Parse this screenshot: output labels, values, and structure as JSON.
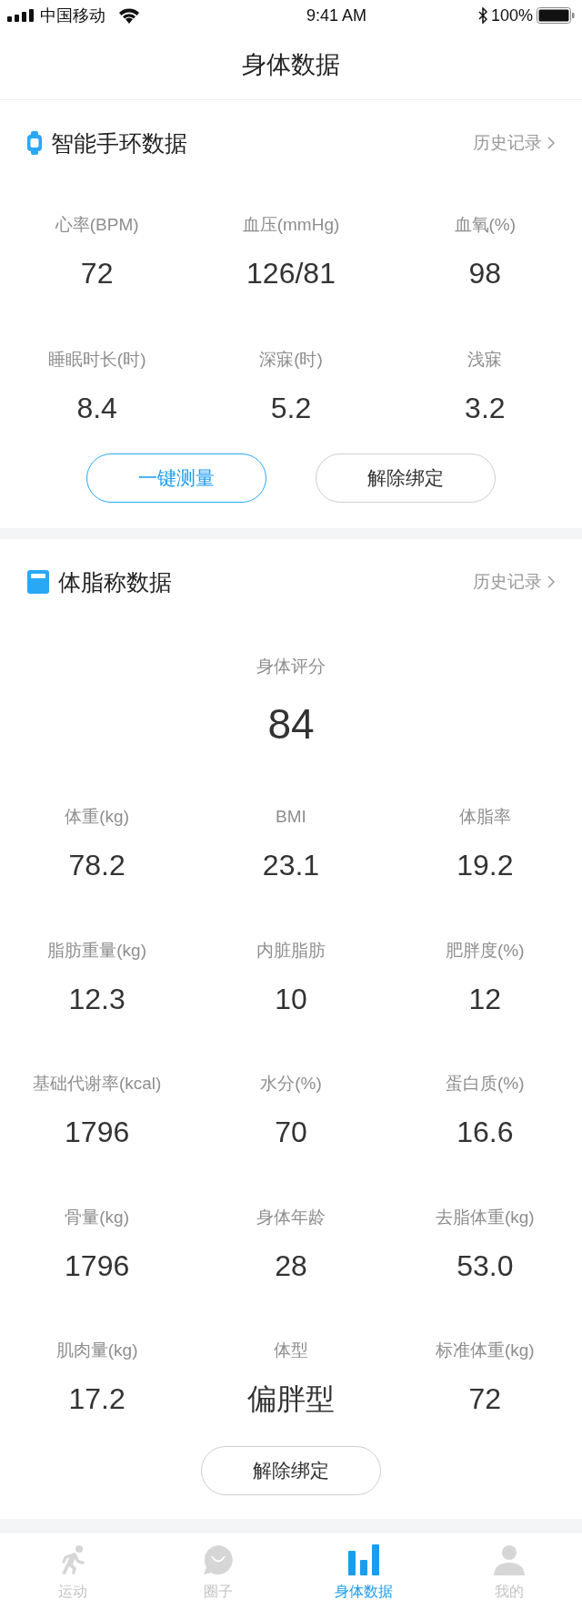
{
  "status_bar": {
    "carrier": "中国移动",
    "time": "9:41 AM",
    "battery": "100%"
  },
  "title": "身体数据",
  "sections": [
    {
      "kind": "watch",
      "title": "智能手环数据",
      "history_link": "历史记录",
      "metrics": [
        {
          "label": "心率(BPM)",
          "value": "72"
        },
        {
          "label": "血压(mmHg)",
          "value": "126/81"
        },
        {
          "label": "血氧(%)",
          "value": "98"
        },
        {
          "label": "睡眠时长(时)",
          "value": "8.4"
        },
        {
          "label": "深寐(时)",
          "value": "5.2"
        },
        {
          "label": "浅寐",
          "value": "3.2"
        }
      ],
      "buttons": [
        {
          "label": "一键测量",
          "kind": "primary"
        },
        {
          "label": "解除绑定",
          "kind": "secondary"
        }
      ]
    },
    {
      "kind": "scale",
      "title": "体脂称数据",
      "history_link": "历史记录",
      "score": {
        "label": "身体评分",
        "value": "84"
      },
      "metrics": [
        {
          "label": "体重(kg)",
          "value": "78.2"
        },
        {
          "label": "BMI",
          "value": "23.1"
        },
        {
          "label": "体脂率",
          "value": "19.2"
        },
        {
          "label": "脂肪重量(kg)",
          "value": "12.3"
        },
        {
          "label": "内脏脂肪",
          "value": "10"
        },
        {
          "label": "肥胖度(%)",
          "value": "12"
        },
        {
          "label": "基础代谢率(kcal)",
          "value": "1796"
        },
        {
          "label": "水分(%)",
          "value": "70"
        },
        {
          "label": "蛋白质(%)",
          "value": "16.6"
        },
        {
          "label": "骨量(kg)",
          "value": "1796"
        },
        {
          "label": "身体年龄",
          "value": "28"
        },
        {
          "label": "去脂体重(kg)",
          "value": "53.0"
        },
        {
          "label": "肌肉量(kg)",
          "value": "17.2"
        },
        {
          "label": "体型",
          "value": "偏胖型"
        },
        {
          "label": "标准体重(kg)",
          "value": "72"
        }
      ],
      "buttons": [
        {
          "label": "解除绑定",
          "kind": "secondary"
        }
      ]
    }
  ],
  "tabs": [
    {
      "kind": "run",
      "label": "运动",
      "selected": false
    },
    {
      "kind": "chat",
      "label": "圈子",
      "selected": false
    },
    {
      "kind": "chart",
      "label": "身体数据",
      "selected": true
    },
    {
      "kind": "person",
      "label": "我的",
      "selected": false
    }
  ]
}
